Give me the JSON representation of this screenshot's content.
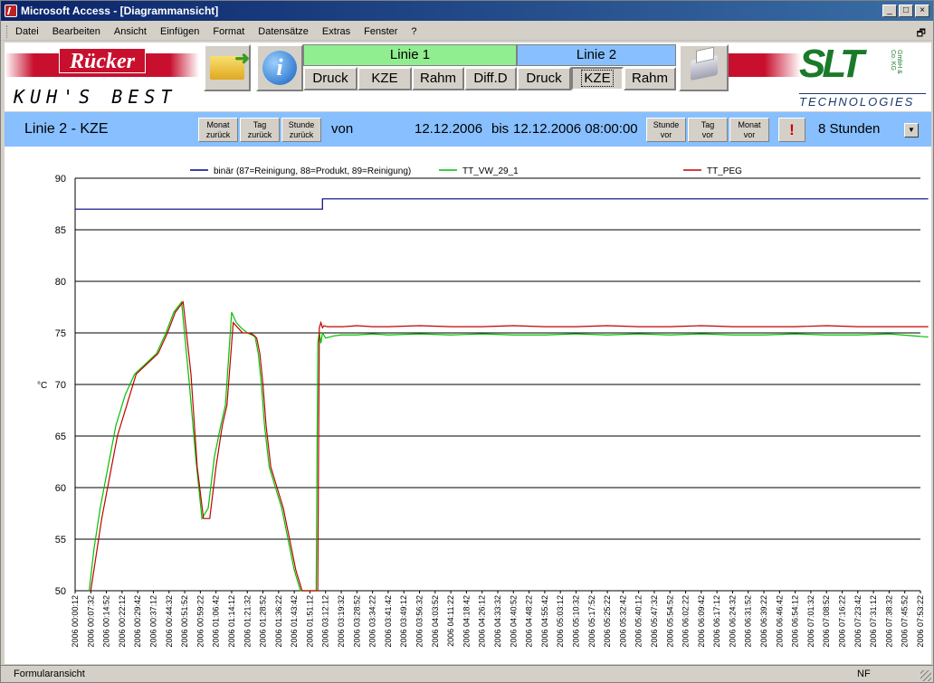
{
  "window": {
    "title": "Microsoft Access - [Diagrammansicht]",
    "min": "_",
    "max": "□",
    "close": "×",
    "restore": "🗗"
  },
  "menu": [
    "Datei",
    "Bearbeiten",
    "Ansicht",
    "Einfügen",
    "Format",
    "Datensätze",
    "Extras",
    "Fenster",
    "?"
  ],
  "logos": {
    "rucker": "Rücker",
    "kuhs": "KUH'S BEST",
    "slt": "SLT",
    "slt_sub": "GmbH & Co. KG",
    "tech": "TECHNOLOGIES"
  },
  "lines": {
    "linie1": {
      "label": "Linie 1",
      "buttons": [
        "Druck",
        "KZE",
        "Rahm",
        "Diff.D"
      ]
    },
    "linie2": {
      "label": "Linie 2",
      "buttons": [
        "Druck",
        "KZE",
        "Rahm"
      ],
      "selected": "KZE"
    },
    "linie1_color": "#90ee90",
    "linie2_color": "#87bfff"
  },
  "nav": {
    "title": "Linie 2 - KZE",
    "monat_zurueck": [
      "Monat",
      "zurück"
    ],
    "tag_zurueck": [
      "Tag",
      "zurück"
    ],
    "stunde_zurueck": [
      "Stunde",
      "zurück"
    ],
    "von": "von",
    "from_date": "12.12.2006",
    "bis": "bis",
    "to_date": "12.12.2006 08:00:00",
    "stunde_vor": [
      "Stunde",
      "vor"
    ],
    "tag_vor": [
      "Tag",
      "vor"
    ],
    "monat_vor": [
      "Monat",
      "vor"
    ],
    "alert": "!",
    "range": "8 Stunden"
  },
  "status": {
    "left": "Formularansicht",
    "right": "NF"
  },
  "chart_data": {
    "type": "line",
    "ylabel": "°C",
    "ylim": [
      50,
      90
    ],
    "yticks": [
      50,
      55,
      60,
      65,
      70,
      75,
      80,
      85,
      90
    ],
    "grid": true,
    "legend_position": "top",
    "x_tick_labels": [
      "2006 00:00:12",
      "2006 00:07:32",
      "2006 00:14:52",
      "2006 00:22:12",
      "2006 00:29:42",
      "2006 00:37:12",
      "2006 00:44:32",
      "2006 00:51:52",
      "2006 00:59:22",
      "2006 01:06:42",
      "2006 01:14:12",
      "2006 01:21:32",
      "2006 01:28:52",
      "2006 01:36:22",
      "2006 01:43:42",
      "2006 01:51:12",
      "2006 03:12:12",
      "2006 03:19:32",
      "2006 03:28:52",
      "2006 03:34:22",
      "2006 03:41:42",
      "2006 03:49:12",
      "2006 03:56:32",
      "2006 04:03:52",
      "2006 04:11:22",
      "2006 04:18:42",
      "2006 04:26:12",
      "2006 04:33:32",
      "2006 04:40:52",
      "2006 04:48:22",
      "2006 04:55:42",
      "2006 05:03:12",
      "2006 05:10:32",
      "2006 05:17:52",
      "2006 05:25:22",
      "2006 05:32:42",
      "2006 05:40:12",
      "2006 05:47:32",
      "2006 05:54:52",
      "2006 06:02:22",
      "2006 06:09:42",
      "2006 06:17:12",
      "2006 06:24:32",
      "2006 06:31:52",
      "2006 06:39:22",
      "2006 06:46:42",
      "2006 06:54:12",
      "2006 07:01:32",
      "2006 07:08:52",
      "2006 07:16:22",
      "2006 07:23:42",
      "2006 07:31:12",
      "2006 07:38:32",
      "2006 07:45:52",
      "2006 07:53:22"
    ],
    "series": [
      {
        "name": "binär (87=Reinigung, 88=Produkt, 89=Reinigung)",
        "color": "#000080",
        "x": [
          0,
          15.8,
          15.8,
          54.5
        ],
        "y": [
          87,
          87,
          88,
          88
        ]
      },
      {
        "name": "TT_VW_29_1",
        "color": "#00c000",
        "x": [
          0.9,
          1.2,
          1.6,
          2.1,
          2.6,
          3.2,
          3.8,
          4.5,
          5.2,
          5.8,
          6.3,
          6.8,
          7.3,
          7.7,
          8.1,
          8.5,
          8.9,
          9.3,
          9.6,
          10.0,
          10.3,
          10.6,
          11.0,
          11.3,
          11.5,
          11.7,
          11.9,
          12.1,
          12.4,
          12.8,
          13.2,
          13.6,
          14.0,
          14.4,
          14.7,
          15.0,
          15.2,
          15.4,
          15.5,
          15.6,
          15.7,
          15.8,
          16.0,
          16.5,
          17.0,
          18,
          19,
          20,
          22,
          24,
          26,
          28,
          30,
          32,
          34,
          36,
          38,
          40,
          42,
          44,
          46,
          48,
          50,
          52,
          54.5
        ],
        "y": [
          50,
          54,
          58,
          62,
          66,
          69,
          71,
          72,
          73,
          75,
          77,
          78,
          70,
          63,
          57,
          58,
          63,
          66,
          68,
          77,
          76,
          75.5,
          75,
          74.8,
          74.6,
          73,
          70,
          66,
          62,
          60,
          58,
          55,
          52,
          50,
          50,
          50,
          50,
          50,
          74,
          75,
          74,
          75,
          74.5,
          74.7,
          74.8,
          74.8,
          74.9,
          74.8,
          74.9,
          74.8,
          74.9,
          74.8,
          74.8,
          74.9,
          74.8,
          74.9,
          74.8,
          74.9,
          74.8,
          74.8,
          74.9,
          74.8,
          74.8,
          74.9,
          74.6
        ]
      },
      {
        "name": "TT_PEG",
        "color": "#c00000",
        "x": [
          1.0,
          1.3,
          1.7,
          2.2,
          2.7,
          3.3,
          3.9,
          4.6,
          5.3,
          5.9,
          6.4,
          6.9,
          7.4,
          7.8,
          8.2,
          8.6,
          9.0,
          9.4,
          9.7,
          10.1,
          10.4,
          10.7,
          11.1,
          11.4,
          11.6,
          11.8,
          12.0,
          12.2,
          12.5,
          12.9,
          13.3,
          13.7,
          14.1,
          14.5,
          14.8,
          15.1,
          15.3,
          15.5,
          15.6,
          15.7,
          15.8,
          15.9,
          16.1,
          16.6,
          17.1,
          18,
          19,
          20,
          22,
          24,
          26,
          28,
          30,
          32,
          34,
          36,
          38,
          40,
          42,
          44,
          46,
          48,
          50,
          52,
          54.5
        ],
        "y": [
          50,
          53,
          57,
          61,
          65,
          68,
          71,
          72,
          73,
          75,
          77,
          78,
          71,
          62,
          57,
          57,
          62,
          66,
          68,
          76,
          75.5,
          75,
          75,
          74.8,
          74.5,
          73,
          70,
          66,
          62,
          60,
          58,
          55,
          52,
          50,
          50,
          50,
          50,
          50,
          75.5,
          76,
          75.5,
          75.7,
          75.6,
          75.6,
          75.6,
          75.7,
          75.6,
          75.6,
          75.7,
          75.6,
          75.6,
          75.7,
          75.6,
          75.6,
          75.7,
          75.6,
          75.6,
          75.7,
          75.6,
          75.6,
          75.6,
          75.7,
          75.6,
          75.6,
          75.6
        ]
      }
    ]
  }
}
